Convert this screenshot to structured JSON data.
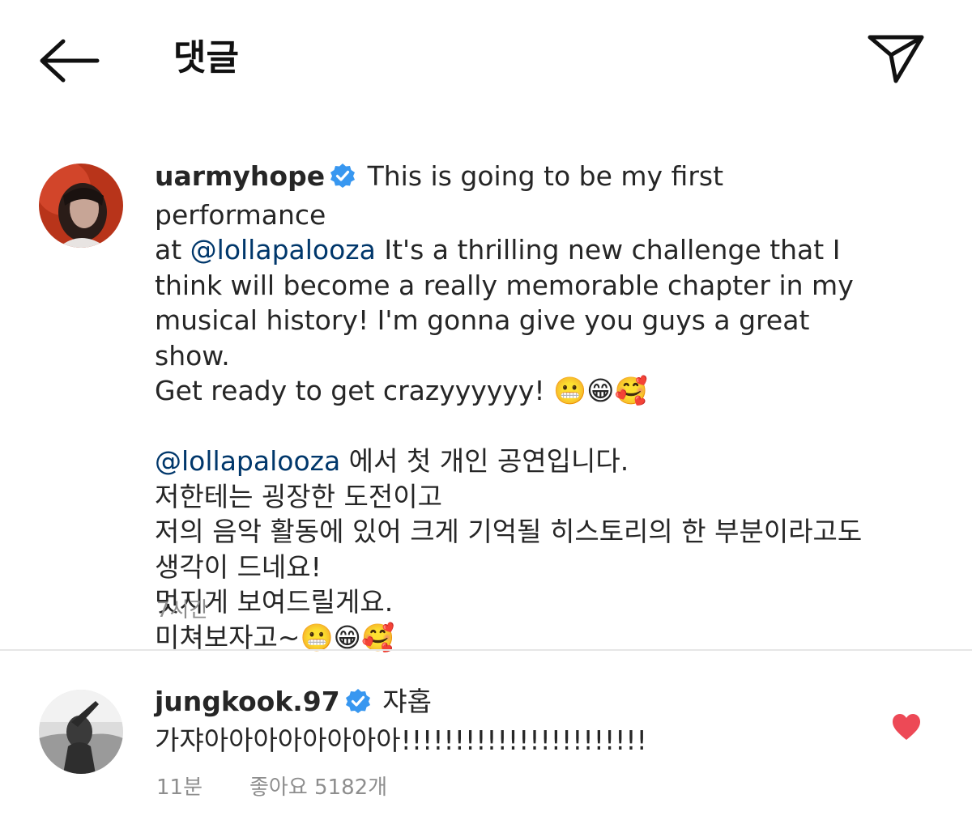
{
  "header": {
    "title": "댓글",
    "back_icon": "arrow-left-icon",
    "share_icon": "paper-plane-icon"
  },
  "caption": {
    "username": "uarmyhope",
    "verified": true,
    "text_en_1": " This is going to be my first performance",
    "text_en_2a": "at ",
    "mention": "@lollapalooza",
    "text_en_2b": " It's a thrilling new challenge that I",
    "text_en_3": "think will become a really memorable chapter in my",
    "text_en_4": "musical history! I'm gonna give you guys a great show.",
    "text_en_5": "Get ready to get crazyyyyyy! ",
    "emojis": "😬😁🥰",
    "mention_kr": "@lollapalooza",
    "text_kr_1": " 에서 첫 개인 공연입니다.",
    "text_kr_2": "저한테는 굉장한 도전이고",
    "text_kr_3": "저의 음악 활동에 있어 크게 기억될 히스토리의 한 부분이라고도",
    "text_kr_4": "생각이 드네요!",
    "text_kr_5": "멋지게 보여드릴게요.",
    "text_kr_6": "미쳐보자고~",
    "time": "7시간"
  },
  "reply": {
    "username": "jungkook.97",
    "verified": true,
    "line1": " 쟈홉",
    "line2": "가쟈아아아아아아아아!!!!!!!!!!!!!!!!!!!!!!!",
    "time": "11분",
    "likes": "좋아요 5182개",
    "liked": true,
    "like_color": "#ed4956"
  },
  "colors": {
    "verified_blue": "#3897f0",
    "mention": "#00376b",
    "meta": "#8e8e8e"
  }
}
